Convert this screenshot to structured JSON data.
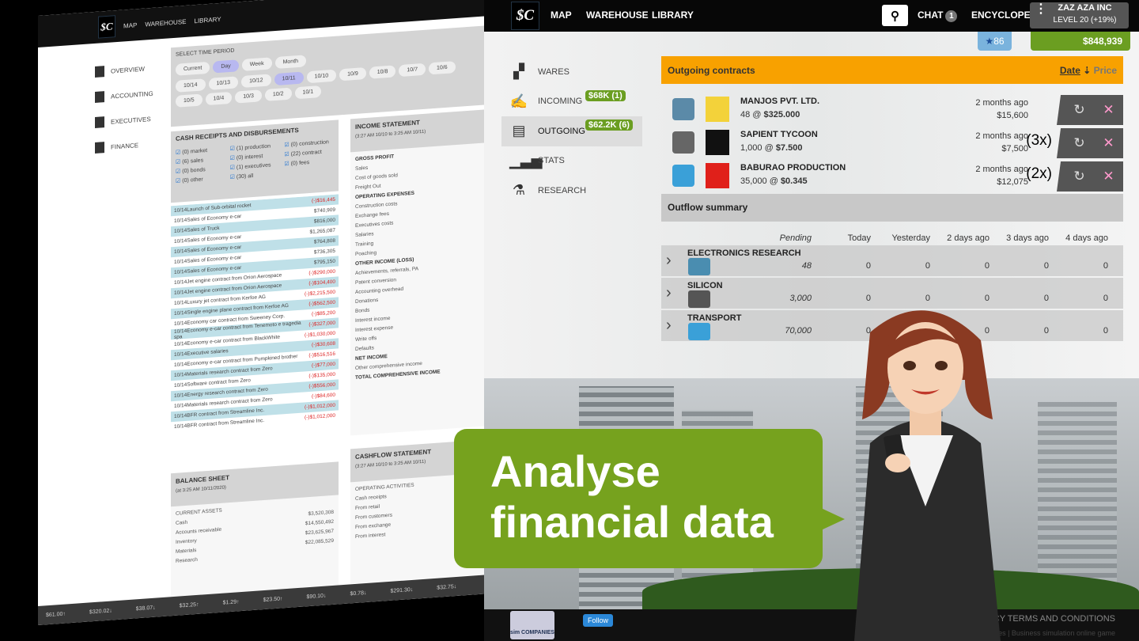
{
  "left_screen": {
    "logo": "$C",
    "nav": [
      "MAP",
      "WAREHOUSE",
      "LIBRARY"
    ],
    "sidebar": [
      "OVERVIEW",
      "ACCOUNTING",
      "EXECUTIVES",
      "FINANCE"
    ],
    "time_period": {
      "title": "SELECT TIME PERIOD",
      "ranges": [
        "Current",
        "Day",
        "Week",
        "Month"
      ],
      "selected_range": "Day",
      "dates": [
        "10/14",
        "10/13",
        "10/12",
        "10/11",
        "10/10",
        "10/9",
        "10/8",
        "10/7",
        "10/6",
        "10/5",
        "10/4",
        "10/3",
        "10/2",
        "10/1"
      ],
      "selected_date": "10/11"
    },
    "cash": {
      "title": "CASH RECEIPTS AND DISBURSEMENTS",
      "filters": [
        "(0) market",
        "(1) production",
        "(0) construction",
        "(6) sales",
        "(0) interest",
        "(22) contract",
        "(0) bonds",
        "(1) executives",
        "(0) fees",
        "(0) other",
        "(30) all"
      ],
      "rows": [
        [
          "10/14Launch of Sub-orbital rocket",
          "(-)$16,445"
        ],
        [
          "10/14Sales of Economy e-car",
          "$740,909"
        ],
        [
          "10/14Sales of Truck",
          "$816,000"
        ],
        [
          "10/14Sales of Economy e-car",
          "$1,265,087"
        ],
        [
          "10/14Sales of Economy e-car",
          "$764,808"
        ],
        [
          "10/14Sales of Economy e-car",
          "$736,305"
        ],
        [
          "10/14Sales of Economy e-car",
          "$795,150"
        ],
        [
          "10/14Jet engine contract from Orion Aerospace",
          "(-)$290,000"
        ],
        [
          "10/14Jet engine contract from Orion Aerospace",
          "(-)$104,400"
        ],
        [
          "10/14Luxury jet contract from Kerfoe AG",
          "(-)$2,215,500"
        ],
        [
          "10/14Single engine plane contract from Kerfoe AG",
          "(-)$562,500"
        ],
        [
          "10/14Economy car contract from Sweeney Corp.",
          "(-)$85,200"
        ],
        [
          "10/14Economy e-car contract from Tenemoto e tragedia spa",
          "(-)$327,000"
        ],
        [
          "10/14Economy e-car contract from BlackWhite",
          "(-)$1,030,000"
        ],
        [
          "10/14Executive salaries",
          "(-)$30,608"
        ],
        [
          "10/14Economy e-car contract from Pumpkined brother",
          "(-)$516,516"
        ],
        [
          "10/14Materials research contract from Zero",
          "(-)$77,000"
        ],
        [
          "10/14Software contract from Zero",
          "(-)$135,000"
        ],
        [
          "10/14Energy research contract from Zero",
          "(-)$556,000"
        ],
        [
          "10/14Materials research contract from Zero",
          "(-)$84,600"
        ],
        [
          "10/14BFR contract from Streamline Inc.",
          "(-)$1,012,000"
        ],
        [
          "10/14BFR contract from Streamline Inc.",
          "(-)$1,012,000"
        ]
      ]
    },
    "income": {
      "title": "INCOME STATEMENT",
      "period": "(3:27 AM 10/10 to 3:25 AM 10/11)",
      "lines": [
        "GROSS PROFIT",
        "Sales",
        "Cost of goods sold",
        "Freight Out",
        "OPERATING EXPENSES",
        "Construction costs",
        "Exchange fees",
        "Executives costs",
        "Salaries",
        "Training",
        "Poaching",
        "OTHER INCOME (LOSS)",
        "Achievements, referrals, PA",
        "Patent conversion",
        "Accounting overhead",
        "Donations",
        "Bonds",
        "Interest income",
        "Interest expense",
        "Write offs",
        "Defaults",
        "NET INCOME",
        "Other comprehensive income",
        "TOTAL COMPREHENSIVE INCOME"
      ]
    },
    "balance": {
      "title": "BALANCE SHEET",
      "date": "(at 3:25 AM 10/11/2020)",
      "lines": [
        [
          "CURRENT ASSETS",
          ""
        ],
        [
          "Cash",
          "$3,520,308"
        ],
        [
          "Accounts receivable",
          "$14,550,492"
        ],
        [
          "Inventory",
          "$23,625,967"
        ],
        [
          "Materials",
          "$22,085,529"
        ],
        [
          "Research",
          ""
        ]
      ]
    },
    "cashflow": {
      "title": "CASHFLOW STATEMENT",
      "period": "(3:27 AM 10/10 to 3:25 AM 10/11)",
      "lines": [
        "OPERATING ACTIVITIES",
        "Cash receipts",
        "From retail",
        "From customers",
        "From exchange",
        "From interest"
      ]
    },
    "ticker": [
      "$61.00↑",
      "$320.02↓",
      "$38.07↓",
      "$32.25↑",
      "$1.29↑",
      "$23.50↑",
      "$90.10↓",
      "$0.78↓",
      "$291.30↓",
      "$32.75↓"
    ]
  },
  "nav": {
    "logo": "$C",
    "links": [
      "MAP",
      "WAREHOUSE",
      "LIBRARY"
    ],
    "chat": "CHAT",
    "chat_count": "1",
    "encyclopedia": "ENCYCLOPEDIA",
    "company": "ZAZ AZA INC",
    "level": "LEVEL 20 (+19%)",
    "stars": "86",
    "money": "$848,939"
  },
  "sidebar": [
    {
      "label": "WARES",
      "icon": "boxes-icon"
    },
    {
      "label": "INCOMING",
      "icon": "sign-contract-icon",
      "badge": "$68K (1)"
    },
    {
      "label": "OUTGOING",
      "icon": "document-icon",
      "badge": "$62.2K (6)",
      "active": true
    },
    {
      "label": "STATS",
      "icon": "bar-chart-icon"
    },
    {
      "label": "RESEARCH",
      "icon": "flask-icon"
    }
  ],
  "outgoing": {
    "title": "Outgoing contracts",
    "sort_date": "Date",
    "sort_price": "Price",
    "contracts": [
      {
        "company": "MANJOS PVT. LTD.",
        "qty": "48 @ ",
        "price": "$325.000",
        "when": "2 months ago",
        "total": "$15,600",
        "mult": ""
      },
      {
        "company": "SAPIENT TYCOON",
        "qty": "1,000 @ ",
        "price": "$7.500",
        "when": "2 months ago",
        "total": "$7,500",
        "mult": "(3x)"
      },
      {
        "company": "BABURAO PRODUCTION",
        "qty": "35,000 @ ",
        "price": "$0.345",
        "when": "2 months ago",
        "total": "$12,075",
        "mult": "(2x)"
      }
    ]
  },
  "outflow": {
    "title": "Outflow summary",
    "columns": [
      "Pending",
      "Today",
      "Yesterday",
      "2 days ago",
      "3 days ago",
      "4 days ago"
    ],
    "rows": [
      {
        "name": "ELECTRONICS RESEARCH",
        "values": [
          "48",
          "0",
          "0",
          "0",
          "0",
          "0"
        ],
        "color": "#4a8db0"
      },
      {
        "name": "SILICON",
        "values": [
          "3,000",
          "0",
          "0",
          "0",
          "0",
          "0"
        ],
        "color": "#555"
      },
      {
        "name": "TRANSPORT",
        "values": [
          "70,000",
          "0",
          "0",
          "0",
          "0",
          "0"
        ],
        "color": "#3aa0d8"
      }
    ]
  },
  "callout": {
    "line1": "Analyse",
    "line2": "financial data"
  },
  "footer": {
    "logo": "sim COMPANIES",
    "follow": "Follow",
    "links": "AB…Q  PRIVACY POLICY  TERMS AND CONDITIONS",
    "tagline": "Sim Companies | Business simulation online game"
  },
  "colors": {
    "accent_orange": "#f8a100",
    "accent_green": "#6b9e21",
    "callout_green": "#76a21e"
  }
}
